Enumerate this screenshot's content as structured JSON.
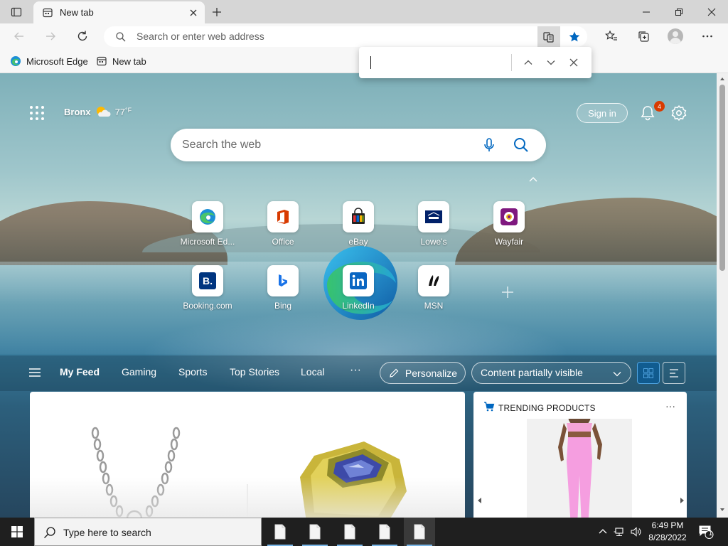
{
  "browser": {
    "tab": {
      "title": "New tab"
    },
    "addressbar": {
      "placeholder": "Search or enter web address"
    },
    "favorites": [
      {
        "label": "Microsoft Edge",
        "icon": "edge-icon"
      },
      {
        "label": "New tab",
        "icon": "page-icon"
      }
    ],
    "find": {
      "value": ""
    }
  },
  "ntp": {
    "weather": {
      "location": "Bronx",
      "temp": "77",
      "unit": "°F",
      "icon": "partly-cloudy-icon"
    },
    "signin_label": "Sign in",
    "notification_count": "4",
    "search_placeholder": "Search the web",
    "quick_links": [
      {
        "label": "Microsoft Ed...",
        "icon": "edge-icon"
      },
      {
        "label": "Office",
        "icon": "office-icon"
      },
      {
        "label": "eBay",
        "icon": "ebay-icon"
      },
      {
        "label": "Lowe's",
        "icon": "lowes-icon"
      },
      {
        "label": "Wayfair",
        "icon": "wayfair-icon"
      },
      {
        "label": "Booking.com",
        "icon": "booking-icon"
      },
      {
        "label": "Bing",
        "icon": "bing-icon"
      },
      {
        "label": "LinkedIn",
        "icon": "linkedin-icon"
      },
      {
        "label": "MSN",
        "icon": "msn-icon"
      }
    ],
    "feed_tabs": [
      "My Feed",
      "Gaming",
      "Sports",
      "Top Stories",
      "Local"
    ],
    "feed_more": "···",
    "personalize_label": "Personalize",
    "content_visibility": "Content partially visible",
    "trending": {
      "title": "TRENDING PRODUCTS",
      "more": "···"
    }
  },
  "taskbar": {
    "search_placeholder": "Type here to search",
    "time": "6:49 PM",
    "date": "8/28/2022",
    "notification_count": "1"
  },
  "colors": {
    "accent": "#0067c0",
    "badge": "#d83b01",
    "taskbar": "#1f1f1f"
  }
}
